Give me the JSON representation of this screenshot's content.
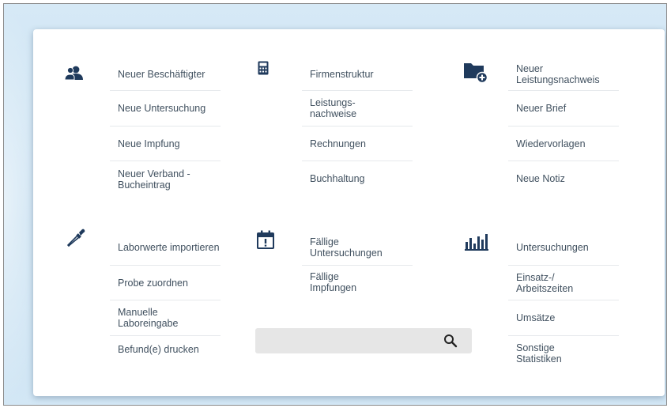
{
  "groups": [
    {
      "icon": "users-icon",
      "items": [
        "Neuer Beschäftigter",
        "Neue Untersuchung",
        "Neue Impfung",
        "Neuer Verband - Bucheintrag"
      ]
    },
    {
      "icon": "calculator-icon",
      "items": [
        "Firmenstruktur",
        "Leistungs- nachweise",
        "Rechnungen",
        "Buchhaltung"
      ]
    },
    {
      "icon": "folder-add-icon",
      "items": [
        "Neuer Leistungsnachweis",
        "Neuer Brief",
        "Wiedervorlagen",
        "Neue Notiz"
      ]
    },
    {
      "icon": "pipette-icon",
      "items": [
        "Laborwerte importieren",
        "Probe zuordnen",
        "Manuelle Laboreingabe",
        "Befund(e) drucken"
      ]
    },
    {
      "icon": "calendar-alert-icon",
      "items": [
        "Fällige Untersuchungen",
        "Fällige Impfungen"
      ]
    },
    {
      "icon": "bar-chart-icon",
      "items": [
        "Untersuchungen",
        "Einsatz-/ Arbeitszeiten",
        "Umsätze",
        "Sonstige Statistiken"
      ]
    }
  ],
  "search": {
    "placeholder": "",
    "value": "",
    "icon": "search-icon"
  },
  "colors": {
    "icon": "#1f3a5c",
    "text": "#40505f",
    "background": "#cfe5f4"
  }
}
